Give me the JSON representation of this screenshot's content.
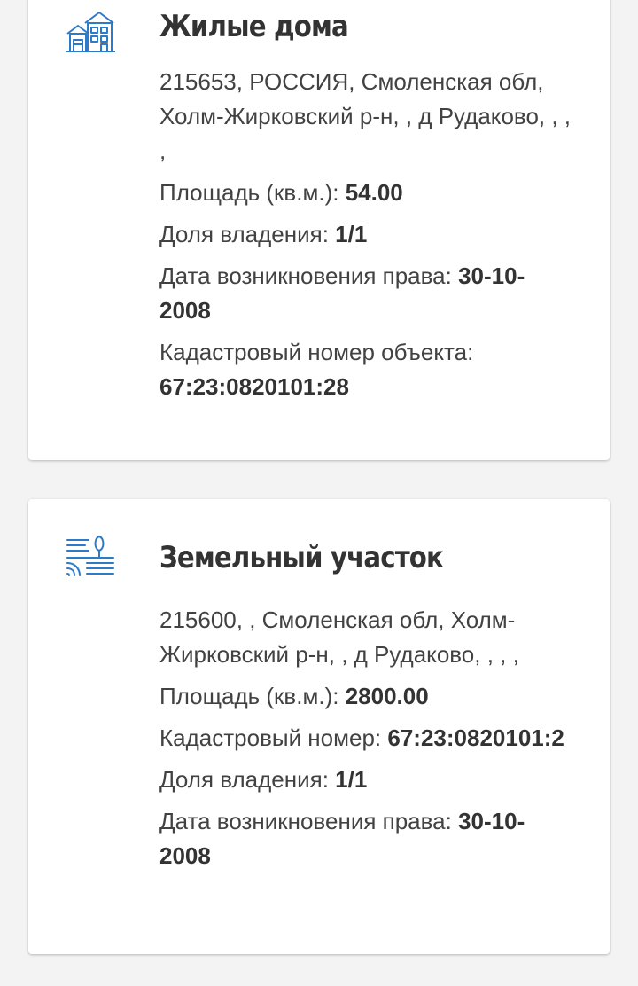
{
  "cards": [
    {
      "icon": "house-icon",
      "title": "Жилые дома",
      "address": "215653, РОССИЯ, Смоленская обл, Холм-Жирковский р-н, , д Рудаково, , , ,",
      "area_label": "Площадь (кв.м.):",
      "area_value": "54.00",
      "share_label": "Доля владения:",
      "share_value": "1/1",
      "date_label": "Дата возникновения права:",
      "date_value": "30-10-2008",
      "cadastral_label": "Кадастровый номер объекта:",
      "cadastral_value": "67:23:0820101:28"
    },
    {
      "icon": "land-plot-icon",
      "title": "Земельный участок",
      "address": "215600, , Смоленская обл, Холм-Жирковский р-н, , д Рудаково, , , ,",
      "area_label": "Площадь (кв.м.):",
      "area_value": "2800.00",
      "cadastral_label": "Кадастровый номер:",
      "cadastral_value": "67:23:0820101:2",
      "share_label": "Доля владения:",
      "share_value": "1/1",
      "date_label": "Дата возникновения права:",
      "date_value": "30-10-2008"
    }
  ],
  "colors": {
    "icon": "#2d7ac9",
    "background": "#f3f3f4"
  }
}
